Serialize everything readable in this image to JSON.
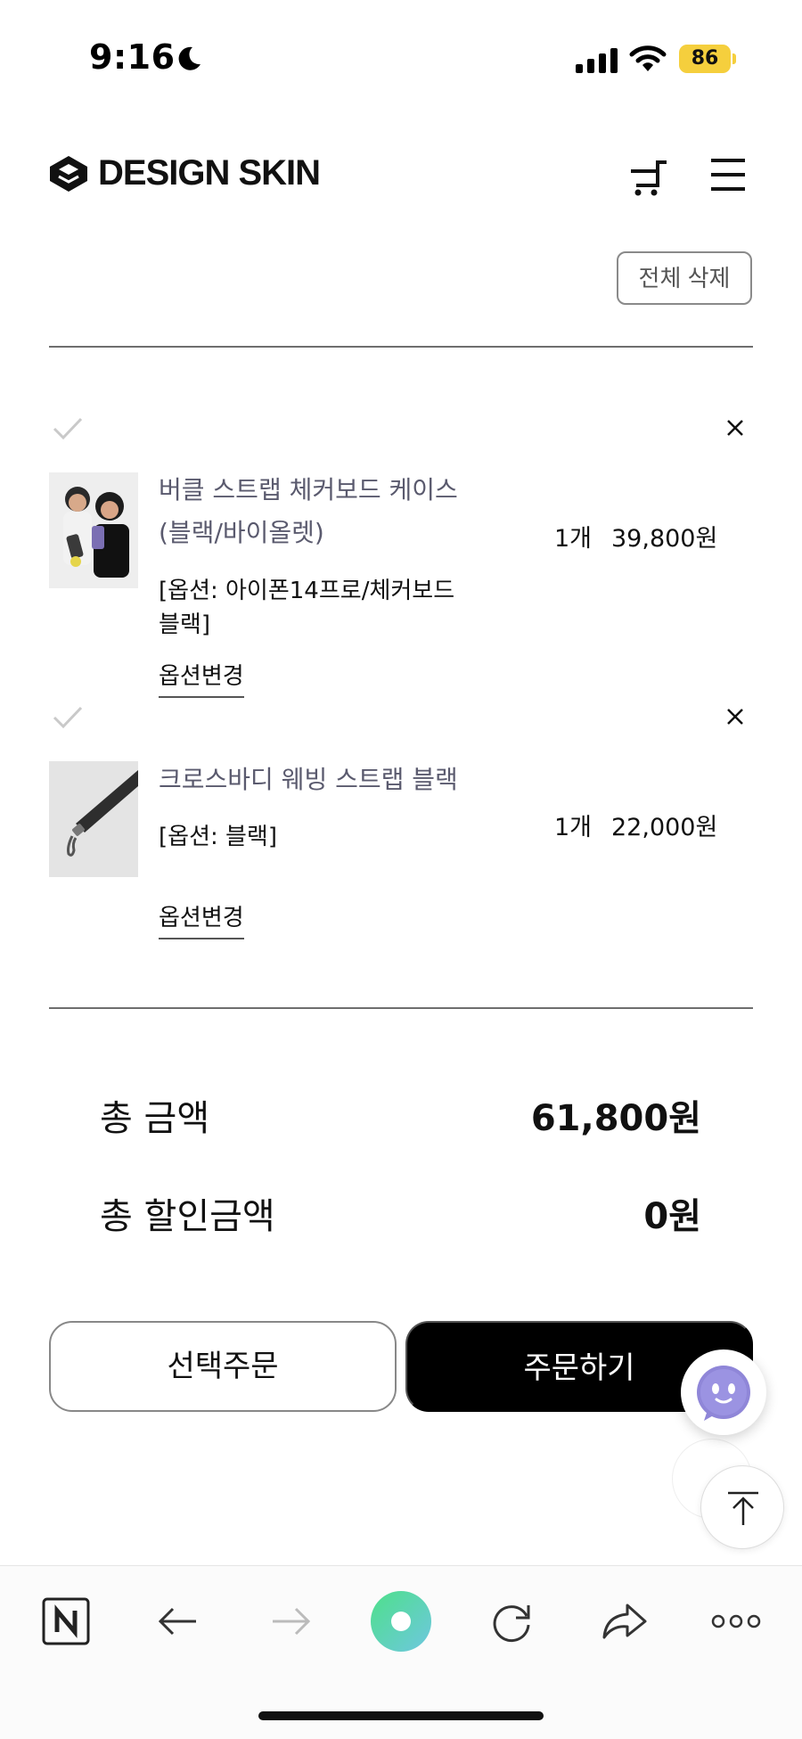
{
  "status_bar": {
    "time": "9:16",
    "battery": "86"
  },
  "header": {
    "brand": "DESIGN SKIN"
  },
  "cart": {
    "delete_all_label": "전체 삭제",
    "items": [
      {
        "name_line1": "버클 스트랩 체커보드 케이스",
        "name_line2": "(블랙/바이올렛)",
        "option_line1": "[옵션: 아이폰14프로/체커보드",
        "option_line2": "블랙]",
        "option_change_label": "옵션변경",
        "quantity": "1개",
        "price": "39,800원"
      },
      {
        "name_line1": "크로스바디 웨빙 스트랩 블랙",
        "option_line1": "[옵션: 블랙]",
        "option_change_label": "옵션변경",
        "quantity": "1개",
        "price": "22,000원"
      }
    ]
  },
  "totals": {
    "total_label": "총 금액",
    "total_value": "61,800원",
    "discount_label": "총 할인금액",
    "discount_value": "0원"
  },
  "actions": {
    "select_order_label": "선택주문",
    "order_label": "주문하기"
  },
  "icons": {
    "moon": "moon-icon",
    "signal": "signal-icon",
    "wifi": "wifi-icon",
    "cart": "cart-icon",
    "menu": "menu-icon",
    "check": "check-icon",
    "close": "close-icon",
    "chatbot": "chatbot-icon",
    "scroll_top": "arrow-up-icon",
    "naver": "naver-n-icon",
    "back": "arrow-left-icon",
    "forward": "arrow-right-icon",
    "green_dot": "green-dot-icon",
    "reload": "reload-icon",
    "share": "share-icon",
    "more": "more-icon"
  },
  "colors": {
    "battery": "#f5cf3d",
    "order_button": "#000000",
    "item_name": "#5a5a6e",
    "green_button": "#5fd3a0"
  }
}
